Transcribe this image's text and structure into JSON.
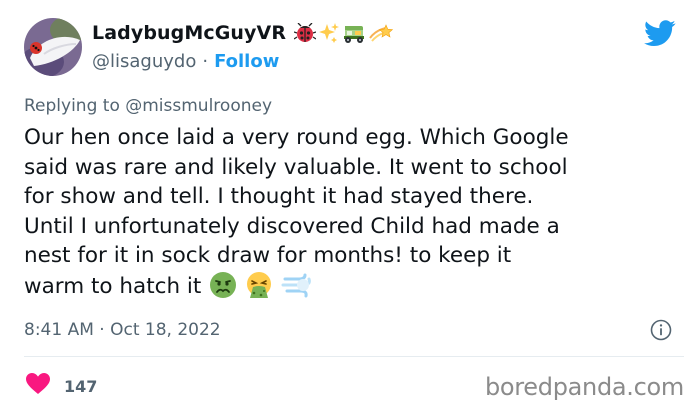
{
  "user": {
    "display_name": "LadybugMcGuyVR",
    "handle": "@lisaguydo",
    "separator": "·",
    "follow_label": "Follow",
    "name_emojis": [
      "ladybug-icon",
      "sparkles-icon",
      "auto-rickshaw-icon",
      "shooting-star-icon"
    ]
  },
  "tweet": {
    "reply_prefix": "Replying to",
    "reply_to": "@missmulrooney",
    "lines": [
      "Our hen once laid a very round egg. Which Google",
      "said was rare and likely valuable. It went to school",
      "for show and tell. I thought it had stayed there.",
      "Until I unfortunately discovered Child had made a",
      "nest for it in  sock draw for months!  to keep it",
      "warm to hatch it"
    ],
    "trailing_emojis": [
      "nauseated-face-icon",
      "vomiting-face-icon",
      "dashing-away-icon"
    ],
    "timestamp": "8:41 AM · Oct 18, 2022"
  },
  "engagement": {
    "likes": "147"
  },
  "watermark": "boredpanda.com",
  "colors": {
    "twitter_blue": "#1d9bf0",
    "secondary_text": "#536471",
    "like_red": "#f91880"
  }
}
